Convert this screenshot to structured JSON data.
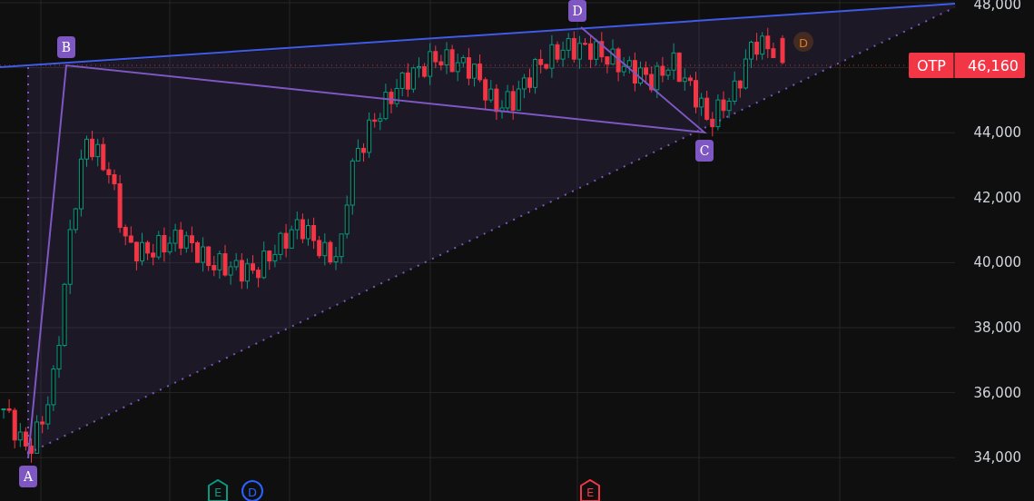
{
  "chart": {
    "y_axis": {
      "labels": [
        "48,000",
        "44,000",
        "42,000",
        "40,000",
        "38,000",
        "36,000",
        "34,000"
      ]
    },
    "price_tag": {
      "symbol": "OTP",
      "price": "46,160"
    },
    "pattern_points": [
      "A",
      "B",
      "C",
      "D"
    ],
    "markers": [
      {
        "letter": "D",
        "kind": "dividend",
        "color": "#e07a1f"
      },
      {
        "letter": "E",
        "kind": "earnings",
        "color": "#089981"
      },
      {
        "letter": "D",
        "kind": "dividend",
        "color": "#2962ff"
      },
      {
        "letter": "E",
        "kind": "earnings",
        "color": "#f23645"
      }
    ]
  }
}
